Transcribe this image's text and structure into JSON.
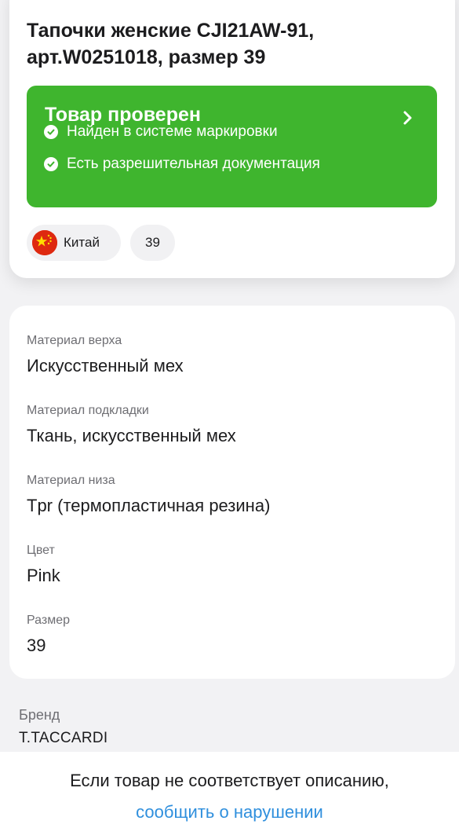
{
  "product": {
    "title_line1": "Тапочки женские CJI21AW-91,",
    "title_line2": "арт.W0251018, размер 39"
  },
  "verification": {
    "title": "Товар проверен",
    "checks": [
      "Найден в системе маркировки",
      "Есть разрешительная документация"
    ],
    "color": "#3fb52e"
  },
  "chips": {
    "country": "Китай",
    "size": "39"
  },
  "details": [
    {
      "label": "Материал верха",
      "value": "Искусственный мех"
    },
    {
      "label": "Материал подкладки",
      "value": "Ткань, искусственный мех"
    },
    {
      "label": "Материал низа",
      "value": "Tpr (термопластичная резина)"
    },
    {
      "label": "Цвет",
      "value": "Pink"
    },
    {
      "label": "Размер",
      "value": "39"
    }
  ],
  "brand": {
    "label": "Бренд",
    "value": "T.TACCARDI"
  },
  "footer": {
    "text": "Если товар не соответствует описанию,",
    "link": "сообщить о нарушении",
    "link_color": "#2f8fdd"
  },
  "icons": {
    "chevron": "chevron-right-icon",
    "check": "check-circle-icon",
    "flag": "china-flag-icon"
  }
}
